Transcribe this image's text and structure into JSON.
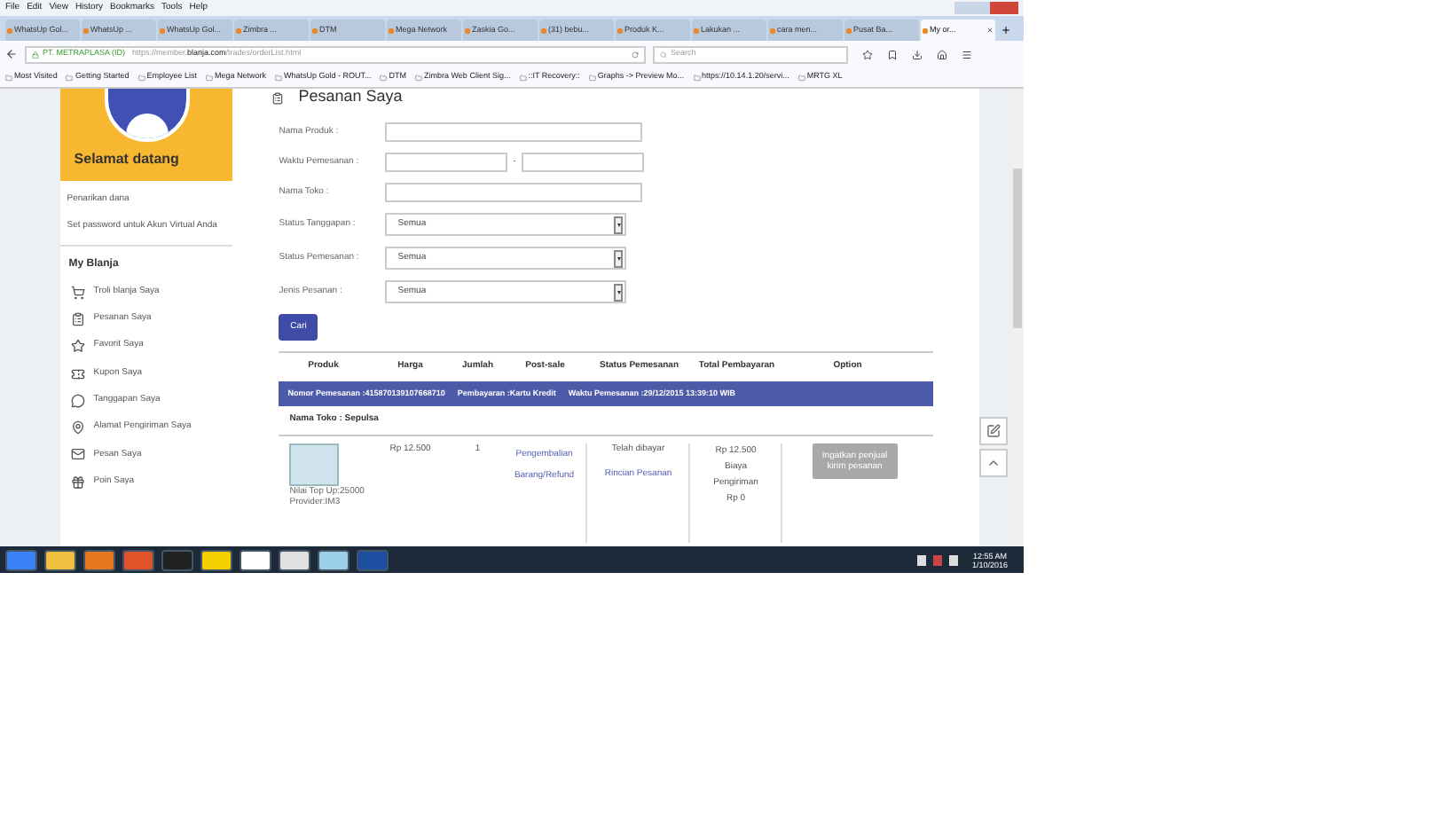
{
  "menu": [
    "File",
    "Edit",
    "View",
    "History",
    "Bookmarks",
    "Tools",
    "Help"
  ],
  "tabs": [
    {
      "label": "WhatsUp Gol...",
      "selected": false
    },
    {
      "label": "WhatsUp ...",
      "selected": false
    },
    {
      "label": "WhatsUp Gol...",
      "selected": false
    },
    {
      "label": "Zimbra ...",
      "selected": false
    },
    {
      "label": "DTM",
      "selected": false
    },
    {
      "label": "Mega Network",
      "selected": false
    },
    {
      "label": "Zaskia Go...",
      "selected": false
    },
    {
      "label": "(31) bebu...",
      "selected": false
    },
    {
      "label": "Produk K...",
      "selected": false
    },
    {
      "label": "Lakukan ...",
      "selected": false
    },
    {
      "label": "cara men...",
      "selected": false
    },
    {
      "label": "Pusat Ba...",
      "selected": false
    },
    {
      "label": "My or...",
      "selected": true
    }
  ],
  "address": {
    "identity": "PT. METRAPLASA (ID)",
    "url_prefix": "https://member.",
    "url_domain": "blanja.com",
    "url_path": "/trades/orderList.html"
  },
  "search": {
    "placeholder": "Search"
  },
  "bookmarks": [
    "Most Visited",
    "Getting Started",
    "Employee List",
    "Mega Network",
    "WhatsUp Gold - ROUT...",
    "DTM",
    "Zimbra Web Client Sig...",
    "::IT Recovery::",
    "Graphs -> Preview Mo...",
    "https://10.14.1.20/servi...",
    "MRTG XL"
  ],
  "sidebar": {
    "welcome": "Selamat datang",
    "links": [
      "Penarikan dana",
      "Set password untuk Akun Virtual Anda"
    ],
    "section": "My Blanja",
    "items": [
      "Troli blanja Saya",
      "Pesanan Saya",
      "Favorit Saya",
      "Kupon Saya",
      "Tanggapan Saya",
      "Alamat Pengiriman Saya",
      "Pesan Saya",
      "Poin Saya"
    ]
  },
  "page_title": "Pesanan Saya",
  "form": [
    {
      "label": "Nama Produk :",
      "kind": "text"
    },
    {
      "label": "Waktu Pemesanan :",
      "kind": "range",
      "separator": "-"
    },
    {
      "label": "Nama Toko :",
      "kind": "text"
    },
    {
      "label": "Status Tanggapan :",
      "kind": "select",
      "value": "Semua"
    },
    {
      "label": "Status Pemesanan :",
      "kind": "select",
      "value": "Semua"
    },
    {
      "label": "Jenis Pesanan :",
      "kind": "select",
      "value": "Semua"
    }
  ],
  "search_button": "Cari",
  "table": {
    "columns": [
      "Produk",
      "Harga",
      "Jumlah",
      "Post-sale",
      "Status Pemesanan",
      "Total Pembayaran",
      "Option"
    ],
    "order_header": [
      "Nomor Pemesanan :415870139107668710",
      "Pembayaran :Kartu Kredit",
      "Waktu Pemesanan :29/12/2015 13:39:10 WIB"
    ],
    "store": "Nama Toko : Sepulsa",
    "item": {
      "product_lines": [
        "Nilai Top Up:25000",
        "Provider:IM3"
      ],
      "price": "Rp 12.500",
      "quantity": "1",
      "post_sale": "Pengembalian Barang/Refund",
      "status": "Telah dibayar",
      "status_link": "Rincian Pesanan",
      "total": [
        "Rp 12.500",
        "Biaya",
        "Pengiriman",
        "Rp 0"
      ],
      "option": "Ingatkan penjual kirim pesanan"
    }
  },
  "taskbar": {
    "time": "12:55 AM",
    "date": "1/10/2016"
  }
}
